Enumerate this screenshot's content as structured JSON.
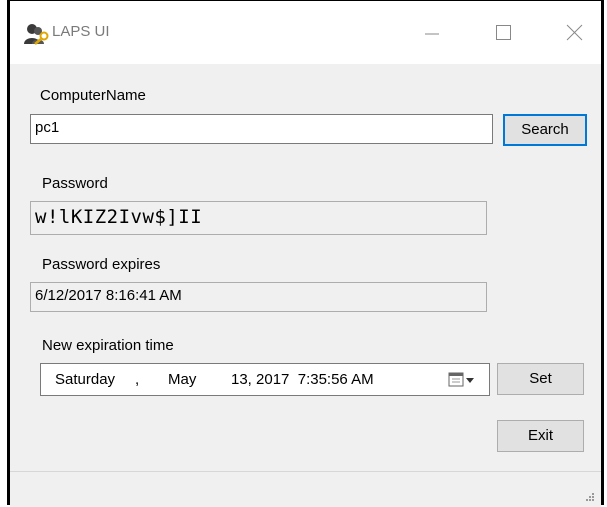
{
  "window": {
    "title": "LAPS UI",
    "app_icon": "users-key-icon",
    "min_icon": "minimize-icon",
    "max_icon": "maximize-icon",
    "close_icon": "close-icon"
  },
  "computer": {
    "label": "ComputerName",
    "value": "pc1",
    "search_label": "Search"
  },
  "password": {
    "label": "Password",
    "value": "w!lKIZ2Ivw$]II"
  },
  "expires": {
    "label": "Password expires",
    "value": "6/12/2017 8:16:41 AM"
  },
  "new_expiration": {
    "label": "New expiration time",
    "weekday": "Saturday",
    "sep": ",",
    "month": "May",
    "day_year_time": "13, 2017  7:35:56 AM",
    "dropdown_icon": "calendar-dropdown-icon",
    "set_label": "Set"
  },
  "exit_label": "Exit",
  "colors": {
    "focus_border": "#0078d7",
    "button_bg": "#e1e1e1",
    "form_bg": "#f0f0f0"
  }
}
